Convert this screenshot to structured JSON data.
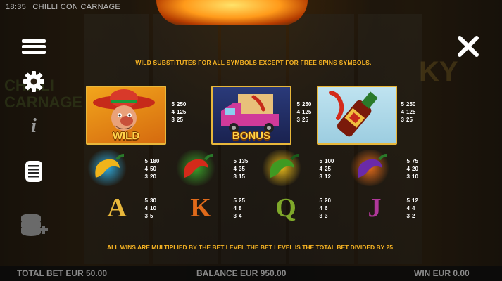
{
  "status_bar": {
    "time": "18:35",
    "game_title": "CHILLI CON CARNAGE"
  },
  "background": {
    "logo_left": "CHILLI CARNAGE",
    "logo_right": "KY"
  },
  "menu": {
    "items": [
      {
        "name": "menu-icon"
      },
      {
        "name": "gear-icon"
      },
      {
        "name": "info-icon",
        "glyph": "i"
      },
      {
        "name": "paytable-icon"
      },
      {
        "name": "coins-icon"
      }
    ]
  },
  "paytable": {
    "wild_note": "WILD SUBSTITUTES FOR ALL SYMBOLS EXCEPT FOR FREE SPINS SYMBOLS.",
    "premium": [
      {
        "id": "wild",
        "label": "WILD",
        "pays": [
          [
            "5",
            "250"
          ],
          [
            "4",
            "125"
          ],
          [
            "3",
            "25"
          ]
        ]
      },
      {
        "id": "bonus",
        "label": "BONUS",
        "pays": [
          [
            "5",
            "250"
          ],
          [
            "4",
            "125"
          ],
          [
            "3",
            "25"
          ]
        ]
      },
      {
        "id": "hot-sauce",
        "label": "",
        "pays": [
          [
            "5",
            "250"
          ],
          [
            "4",
            "125"
          ],
          [
            "3",
            "25"
          ]
        ]
      }
    ],
    "chillies": [
      {
        "id": "yellow-chilli",
        "color": "#f0b41a",
        "glow": "#2fa7d9",
        "pays": [
          [
            "5",
            "180"
          ],
          [
            "4",
            "50"
          ],
          [
            "3",
            "20"
          ]
        ]
      },
      {
        "id": "red-chilli",
        "color": "#d42a1a",
        "glow": "#3aa02a",
        "pays": [
          [
            "5",
            "135"
          ],
          [
            "4",
            "35"
          ],
          [
            "3",
            "15"
          ]
        ]
      },
      {
        "id": "green-chilli",
        "color": "#3f9a22",
        "glow": "#e3b51a",
        "pays": [
          [
            "5",
            "100"
          ],
          [
            "4",
            "25"
          ],
          [
            "3",
            "12"
          ]
        ]
      },
      {
        "id": "purple-chilli",
        "color": "#6a2aa8",
        "glow": "#e06a1a",
        "pays": [
          [
            "5",
            "75"
          ],
          [
            "4",
            "20"
          ],
          [
            "3",
            "10"
          ]
        ]
      }
    ],
    "cards": [
      {
        "id": "card-a",
        "glyph": "A",
        "color": "#e8b73b",
        "pays": [
          [
            "5",
            "30"
          ],
          [
            "4",
            "10"
          ],
          [
            "3",
            "5"
          ]
        ]
      },
      {
        "id": "card-k",
        "glyph": "K",
        "color": "#e06a1a",
        "pays": [
          [
            "5",
            "25"
          ],
          [
            "4",
            "8"
          ],
          [
            "3",
            "4"
          ]
        ]
      },
      {
        "id": "card-q",
        "glyph": "Q",
        "color": "#7fa82a",
        "pays": [
          [
            "5",
            "20"
          ],
          [
            "4",
            "6"
          ],
          [
            "3",
            "3"
          ]
        ]
      },
      {
        "id": "card-j",
        "glyph": "J",
        "color": "#b0389a",
        "pays": [
          [
            "5",
            "12"
          ],
          [
            "4",
            "4"
          ],
          [
            "3",
            "2"
          ]
        ]
      }
    ],
    "bottom_note": "ALL WINS ARE MULTIPLIED BY THE BET LEVEL.THE BET LEVEL IS THE TOTAL BET DIVIDED BY 25"
  },
  "bottom_bar": {
    "total_bet": "TOTAL BET EUR 50.00",
    "balance": "BALANCE EUR 950.00",
    "win": "WIN EUR 0.00"
  }
}
